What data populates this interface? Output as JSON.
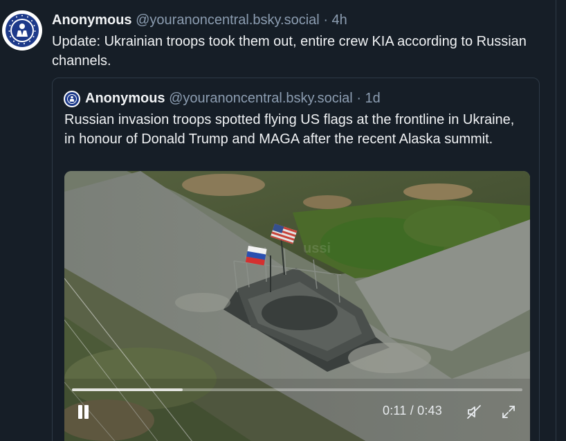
{
  "post": {
    "author_name": "Anonymous",
    "handle": "@youranoncentral.bsky.social",
    "separator": "·",
    "time": "4h",
    "text": "Update: Ukrainian troops took them out, entire crew KIA according to Russian channels."
  },
  "quoted_post": {
    "author_name": "Anonymous",
    "handle": "@youranoncentral.bsky.social",
    "separator": "·",
    "time": "1d",
    "text": "Russian invasion troops spotted flying US flags at the frontline in Ukraine, in honour of Donald Trump and MAGA after the recent Alaska summit."
  },
  "video": {
    "current_time": "0:11",
    "time_separator": "/",
    "duration": "0:43",
    "progress_fraction": 0.246,
    "muted": true
  },
  "icons": {
    "avatar": "anonymous-emblem-icon",
    "pause": "pause-icon",
    "mute": "speaker-muted-icon",
    "fullscreen": "fullscreen-expand-icon"
  },
  "colors": {
    "background": "#161e27",
    "border": "#2e3a47",
    "text_primary": "#f1f3f5",
    "text_secondary": "#8c9db1",
    "avatar_blue": "#1d3a8a"
  }
}
